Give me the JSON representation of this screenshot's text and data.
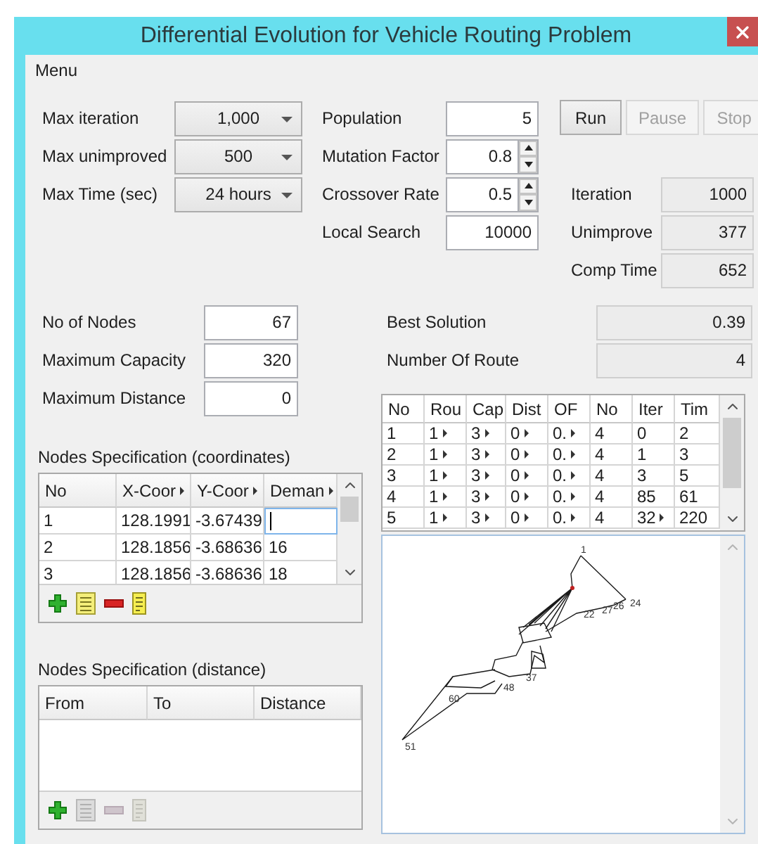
{
  "window": {
    "title": "Differential Evolution for Vehicle Routing Problem"
  },
  "menu": [
    "Menu"
  ],
  "settings": [
    {
      "label": "Max iteration",
      "value": "1,000"
    },
    {
      "label": "Max unimproved",
      "value": "500"
    },
    {
      "label": "Max Time (sec)",
      "value": "24 hours"
    }
  ],
  "parameters": [
    {
      "label": "Population",
      "value": "5",
      "spinner": false
    },
    {
      "label": "Mutation Factor",
      "value": "0.8",
      "spinner": true
    },
    {
      "label": "Crossover Rate",
      "value": "0.5",
      "spinner": true
    },
    {
      "label": "Local Search",
      "value": "10000",
      "spinner": false
    }
  ],
  "buttons": [
    {
      "label": "Run",
      "disabled": false
    },
    {
      "label": "Pause",
      "disabled": true
    },
    {
      "label": "Stop",
      "disabled": true
    }
  ],
  "progress": [
    {
      "label": "Iteration",
      "value": "1000"
    },
    {
      "label": "Unimprove",
      "value": "377"
    },
    {
      "label": "Comp Time",
      "value": "652"
    }
  ],
  "problem": [
    {
      "label": "No of Nodes",
      "value": "67"
    },
    {
      "label": "Maximum Capacity",
      "value": "320"
    },
    {
      "label": "Maximum Distance",
      "value": "0"
    }
  ],
  "results": [
    {
      "label": "Best Solution",
      "value": "0.39"
    },
    {
      "label": "Number Of Route",
      "value": "4"
    }
  ],
  "coordinates_table": {
    "title": "Nodes Specification (coordinates)",
    "columns": [
      {
        "label": "No",
        "truncated": false
      },
      {
        "label": "X-Coor",
        "truncated": true
      },
      {
        "label": "Y-Coor",
        "truncated": true
      },
      {
        "label": "Deman",
        "truncated": true
      }
    ],
    "rows": [
      {
        "cells": [
          {
            "text": "1"
          },
          {
            "text": "128.1991"
          },
          {
            "text": "-3.67439"
          },
          {
            "editing": true
          }
        ]
      },
      {
        "cells": [
          {
            "text": "2"
          },
          {
            "text": "128.1856"
          },
          {
            "text": "-3.68636"
          },
          {
            "text": "16"
          }
        ]
      },
      {
        "cells": [
          {
            "text": "3"
          },
          {
            "text": "128.1856"
          },
          {
            "text": "-3.68636"
          },
          {
            "text": "18"
          }
        ]
      }
    ],
    "toolbar": [
      {
        "kind": "add",
        "disabled": false
      },
      {
        "kind": "insert",
        "disabled": false
      },
      {
        "kind": "remove",
        "disabled": false
      },
      {
        "kind": "edit",
        "disabled": false
      }
    ]
  },
  "distance_table": {
    "title": "Nodes Specification (distance)",
    "columns": [
      {
        "label": "From",
        "truncated": false
      },
      {
        "label": "To",
        "truncated": false
      },
      {
        "label": "Distance",
        "truncated": false
      }
    ],
    "toolbar": [
      {
        "kind": "add",
        "disabled": false
      },
      {
        "kind": "insert",
        "disabled": true
      },
      {
        "kind": "remove",
        "disabled": true
      },
      {
        "kind": "edit",
        "disabled": true
      }
    ]
  },
  "solutions_table": {
    "columns": [
      {
        "label": "No"
      },
      {
        "label": "Rou"
      },
      {
        "label": "Cap"
      },
      {
        "label": "Dist"
      },
      {
        "label": "OF"
      },
      {
        "label": "No"
      },
      {
        "label": "Iter"
      },
      {
        "label": "Tim"
      }
    ],
    "rows": [
      {
        "cells": [
          {
            "text": "1",
            "truncated": false
          },
          {
            "text": "1",
            "truncated": true
          },
          {
            "text": "3",
            "truncated": true
          },
          {
            "text": "0",
            "truncated": true
          },
          {
            "text": "0.",
            "truncated": true
          },
          {
            "text": "4",
            "truncated": false
          },
          {
            "text": "0",
            "truncated": false
          },
          {
            "text": "2",
            "truncated": false
          }
        ]
      },
      {
        "cells": [
          {
            "text": "2",
            "truncated": false
          },
          {
            "text": "1",
            "truncated": true
          },
          {
            "text": "3",
            "truncated": true
          },
          {
            "text": "0",
            "truncated": true
          },
          {
            "text": "0.",
            "truncated": true
          },
          {
            "text": "4",
            "truncated": false
          },
          {
            "text": "1",
            "truncated": false
          },
          {
            "text": "3",
            "truncated": false
          }
        ]
      },
      {
        "cells": [
          {
            "text": "3",
            "truncated": false
          },
          {
            "text": "1",
            "truncated": true
          },
          {
            "text": "3",
            "truncated": true
          },
          {
            "text": "0",
            "truncated": true
          },
          {
            "text": "0.",
            "truncated": true
          },
          {
            "text": "4",
            "truncated": false
          },
          {
            "text": "3",
            "truncated": false
          },
          {
            "text": "5",
            "truncated": false
          }
        ]
      },
      {
        "cells": [
          {
            "text": "4",
            "truncated": false
          },
          {
            "text": "1",
            "truncated": true
          },
          {
            "text": "3",
            "truncated": true
          },
          {
            "text": "0",
            "truncated": true
          },
          {
            "text": "0.",
            "truncated": true
          },
          {
            "text": "4",
            "truncated": false
          },
          {
            "text": "85",
            "truncated": false
          },
          {
            "text": "61",
            "truncated": false
          }
        ]
      },
      {
        "cells": [
          {
            "text": "5",
            "truncated": false
          },
          {
            "text": "1",
            "truncated": true
          },
          {
            "text": "3",
            "truncated": true
          },
          {
            "text": "0",
            "truncated": true
          },
          {
            "text": "0.",
            "truncated": true
          },
          {
            "text": "4",
            "truncated": false
          },
          {
            "text": "32",
            "truncated": true
          },
          {
            "text": "220",
            "truncated": false
          }
        ]
      }
    ]
  },
  "route_plot": {
    "node_labels": [
      "1",
      "24",
      "22",
      "27",
      "26",
      "60",
      "51",
      "48",
      "37"
    ]
  }
}
